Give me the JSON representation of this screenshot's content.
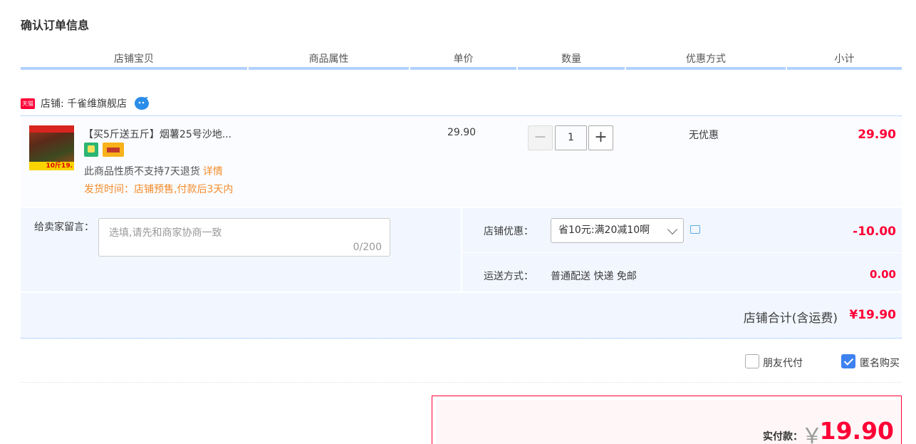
{
  "page": {
    "title": "确认订单信息"
  },
  "columns": [
    "店铺宝贝",
    "商品属性",
    "单价",
    "数量",
    "优惠方式",
    "小计"
  ],
  "shop": {
    "badge": "天猫",
    "label": "店铺: 千雀维旗舰店"
  },
  "item": {
    "thumb_badge": "10斤19.",
    "title": "【买5斤送五斤】烟薯25号沙地...",
    "return_note": "此商品性质不支持7天退货",
    "detail_link": "详情",
    "ship_time": "发货时间：店铺预售,付款后3天内",
    "unit_price": "29.90",
    "quantity": "1",
    "qty_minus": "−",
    "qty_plus": "+",
    "discount": "无优惠",
    "subtotal": "29.90"
  },
  "message": {
    "label": "给卖家留言：",
    "placeholder": "选填,请先和商家协商一致",
    "count": "0/200"
  },
  "promo": {
    "label": "店铺优惠：",
    "selected": "省10元:满20减10啊",
    "amount": "-10.00"
  },
  "shipping": {
    "label": "运送方式：",
    "value": "普通配送 快递 免邮",
    "amount": "0.00"
  },
  "shop_total": {
    "label": "店铺合计(含运费)",
    "amount": "¥19.90"
  },
  "options": {
    "friend_pay": "朋友代付",
    "anonymous": "匿名购买"
  },
  "payment": {
    "label": "实付款：",
    "currency": "￥",
    "amount": "19.90"
  },
  "colors": {
    "accent": "#ff0036",
    "header_rule": "#b2d1ff",
    "panel_bg": "#f2f7ff"
  }
}
